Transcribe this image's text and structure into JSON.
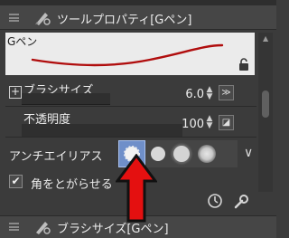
{
  "header": {
    "title": "ツールプロパティ[Gペン]"
  },
  "preview": {
    "label": "Gペン"
  },
  "rows": {
    "brush_size": {
      "label": "ブラシサイズ",
      "value": "6.0"
    },
    "opacity": {
      "label": "不透明度",
      "value": "100"
    },
    "antialias": {
      "label": "アンチエイリアス",
      "options": [
        "none",
        "weak",
        "medium",
        "strong"
      ],
      "selected": "none"
    },
    "sharpen_corners": {
      "label": "角をとがらせる",
      "checked": true
    }
  },
  "panel2": {
    "title": "ブラシサイズ[Gペン]"
  },
  "colors": {
    "selected_highlight": "#6f8fc9",
    "arrow": "#e41010",
    "background": "#3b3b3b"
  },
  "icons": [
    "grip-icon",
    "pen-tool-icon",
    "lock-icon",
    "plus-icon",
    "brush-size-link-icon",
    "opacity-link-icon",
    "chevron-down-icon",
    "timer-icon",
    "wrench-icon"
  ]
}
